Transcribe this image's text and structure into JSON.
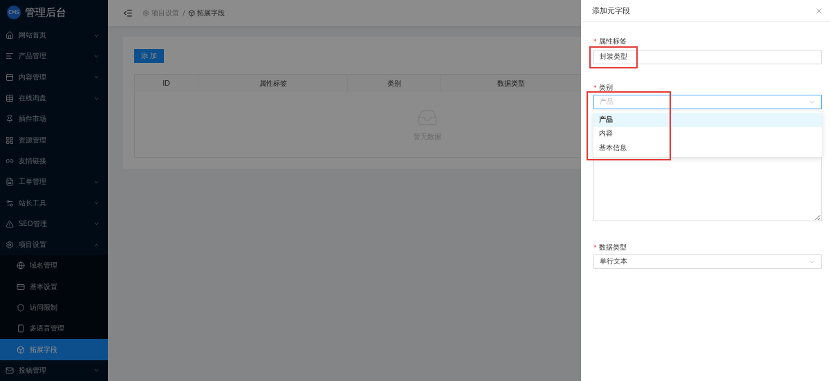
{
  "logo": {
    "badge": "CMS",
    "title": "管理后台"
  },
  "sidebar": {
    "items": [
      {
        "label": "网站首页",
        "expandable": true,
        "expanded": false,
        "selected": false
      },
      {
        "label": "产品管理",
        "expandable": true,
        "expanded": false,
        "selected": false
      },
      {
        "label": "内容管理",
        "expandable": true,
        "expanded": false,
        "selected": false
      },
      {
        "label": "在线询盘",
        "expandable": true,
        "expanded": false,
        "selected": false
      },
      {
        "label": "插件市场",
        "expandable": false,
        "selected": false
      },
      {
        "label": "资源管理",
        "expandable": false,
        "selected": false
      },
      {
        "label": "友情链接",
        "expandable": false,
        "selected": false
      },
      {
        "label": "工单管理",
        "expandable": true,
        "expanded": false,
        "selected": false
      },
      {
        "label": "站长工具",
        "expandable": true,
        "expanded": false,
        "selected": false
      },
      {
        "label": "SEO管理",
        "expandable": true,
        "expanded": false,
        "selected": false
      },
      {
        "label": "项目设置",
        "expandable": true,
        "expanded": true,
        "selected": false,
        "children": [
          {
            "label": "域名管理",
            "selected": false
          },
          {
            "label": "基本设置",
            "selected": false
          },
          {
            "label": "访问限制",
            "selected": false
          },
          {
            "label": "多语言管理",
            "selected": false
          },
          {
            "label": "拓展字段",
            "selected": true
          }
        ]
      },
      {
        "label": "投稿管理",
        "expandable": true,
        "expanded": false,
        "selected": false
      }
    ]
  },
  "breadcrumb": {
    "separator": "/",
    "items": [
      "项目设置",
      "拓展字段"
    ]
  },
  "add_button": "添 加",
  "table": {
    "columns": [
      "ID",
      "属性标签",
      "类别",
      "数据类型"
    ],
    "empty_text": "暂无数据"
  },
  "drawer": {
    "title": "添加元字段",
    "fields": [
      {
        "kind": "input",
        "label": "属性标签",
        "required_mark": "*",
        "value": "封装类型"
      },
      {
        "kind": "select",
        "label": "类别",
        "required_mark": "*",
        "placeholder": "产品",
        "open": true,
        "options": [
          {
            "label": "产品",
            "selected": true
          },
          {
            "label": "内容",
            "selected": false
          },
          {
            "label": "基本信息",
            "selected": false
          }
        ]
      },
      {
        "kind": "textarea"
      },
      {
        "kind": "select",
        "label": "数据类型",
        "required_mark": "*",
        "value": "单行文本",
        "open": false
      }
    ]
  }
}
